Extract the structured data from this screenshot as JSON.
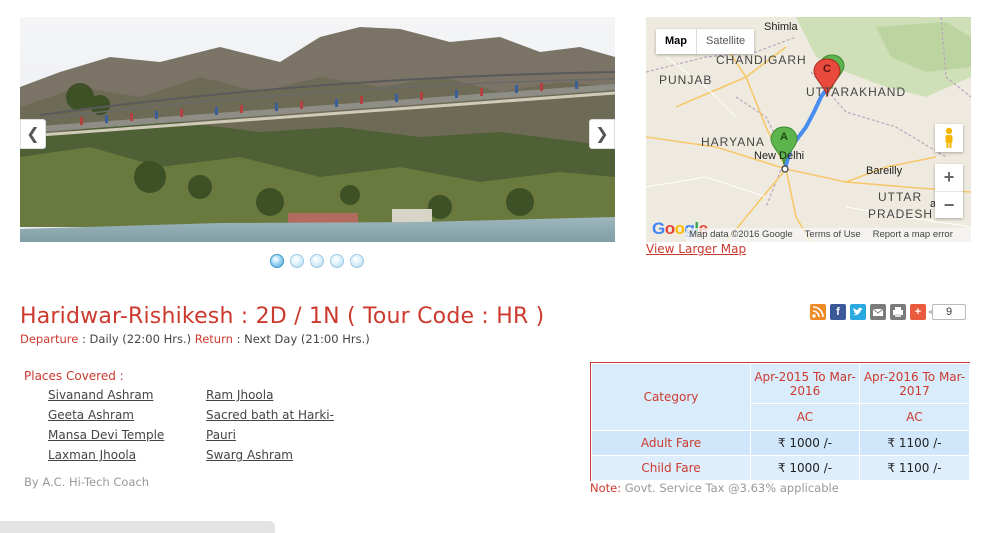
{
  "slider": {
    "prev_arrow": "❮",
    "next_arrow": "❯",
    "dots": 5,
    "active_dot": 1
  },
  "map": {
    "type_map": "Map",
    "type_satellite": "Satellite",
    "labels": {
      "shimla": "Shimla",
      "chandigarh": "CHANDIGARH",
      "punjab": "PUNJAB",
      "uttarakhand": "UTTARAKHAND",
      "haryana": "HARYANA",
      "new_delhi": "New Delhi",
      "bareilly": "Bareilly",
      "uttar": "UTTAR",
      "pradesh": "PRADESH",
      "akh": "akh"
    },
    "markers": {
      "a": "A",
      "c": "C"
    },
    "zoom_in": "+",
    "zoom_out": "−",
    "google": "Google",
    "footer": {
      "map_data": "Map data ©2016 Google",
      "terms": "Terms of Use",
      "report": "Report a map error"
    },
    "view_larger": "View Larger Map"
  },
  "tour": {
    "title": "Haridwar-Rishikesh : 2D / 1N ( Tour Code : HR )",
    "departure_label": "Departure",
    "departure_value": ": Daily (22:00 Hrs.)",
    "return_label": "Return",
    "return_value": ": Next Day (21:00 Hrs.)"
  },
  "share": {
    "icons": [
      "rss-icon",
      "facebook-icon",
      "twitter-icon",
      "email-icon",
      "print-icon",
      "plus-share-icon"
    ],
    "count": "9"
  },
  "places": {
    "heading": "Places Covered :",
    "col1": [
      "Sivanand Ashram",
      "Geeta Ashram",
      "Mansa Devi Temple",
      "Laxman Jhoola"
    ],
    "col2": [
      "Ram Jhoola",
      "Sacred bath at Harki-",
      "Pauri",
      "Swarg Ashram"
    ],
    "by": "By A.C. Hi-Tech Coach"
  },
  "fares": {
    "category": "Category",
    "period1": "Apr-2015 To Mar-2016",
    "period2": "Apr-2016 To Mar-2017",
    "class1": "AC",
    "class2": "AC",
    "rows": [
      {
        "label": "Adult Fare",
        "v1": "₹ 1000 /-",
        "v2": "₹ 1100 /-"
      },
      {
        "label": "Child Fare",
        "v1": "₹ 1000 /-",
        "v2": "₹ 1100 /-"
      }
    ],
    "note_label": "Note:",
    "note_text": "Govt. Service Tax @3.63% applicable"
  },
  "colors": {
    "accent": "#cc3a2e",
    "table_header": "#d9ecfb",
    "table_row": "#cfe6fb"
  }
}
